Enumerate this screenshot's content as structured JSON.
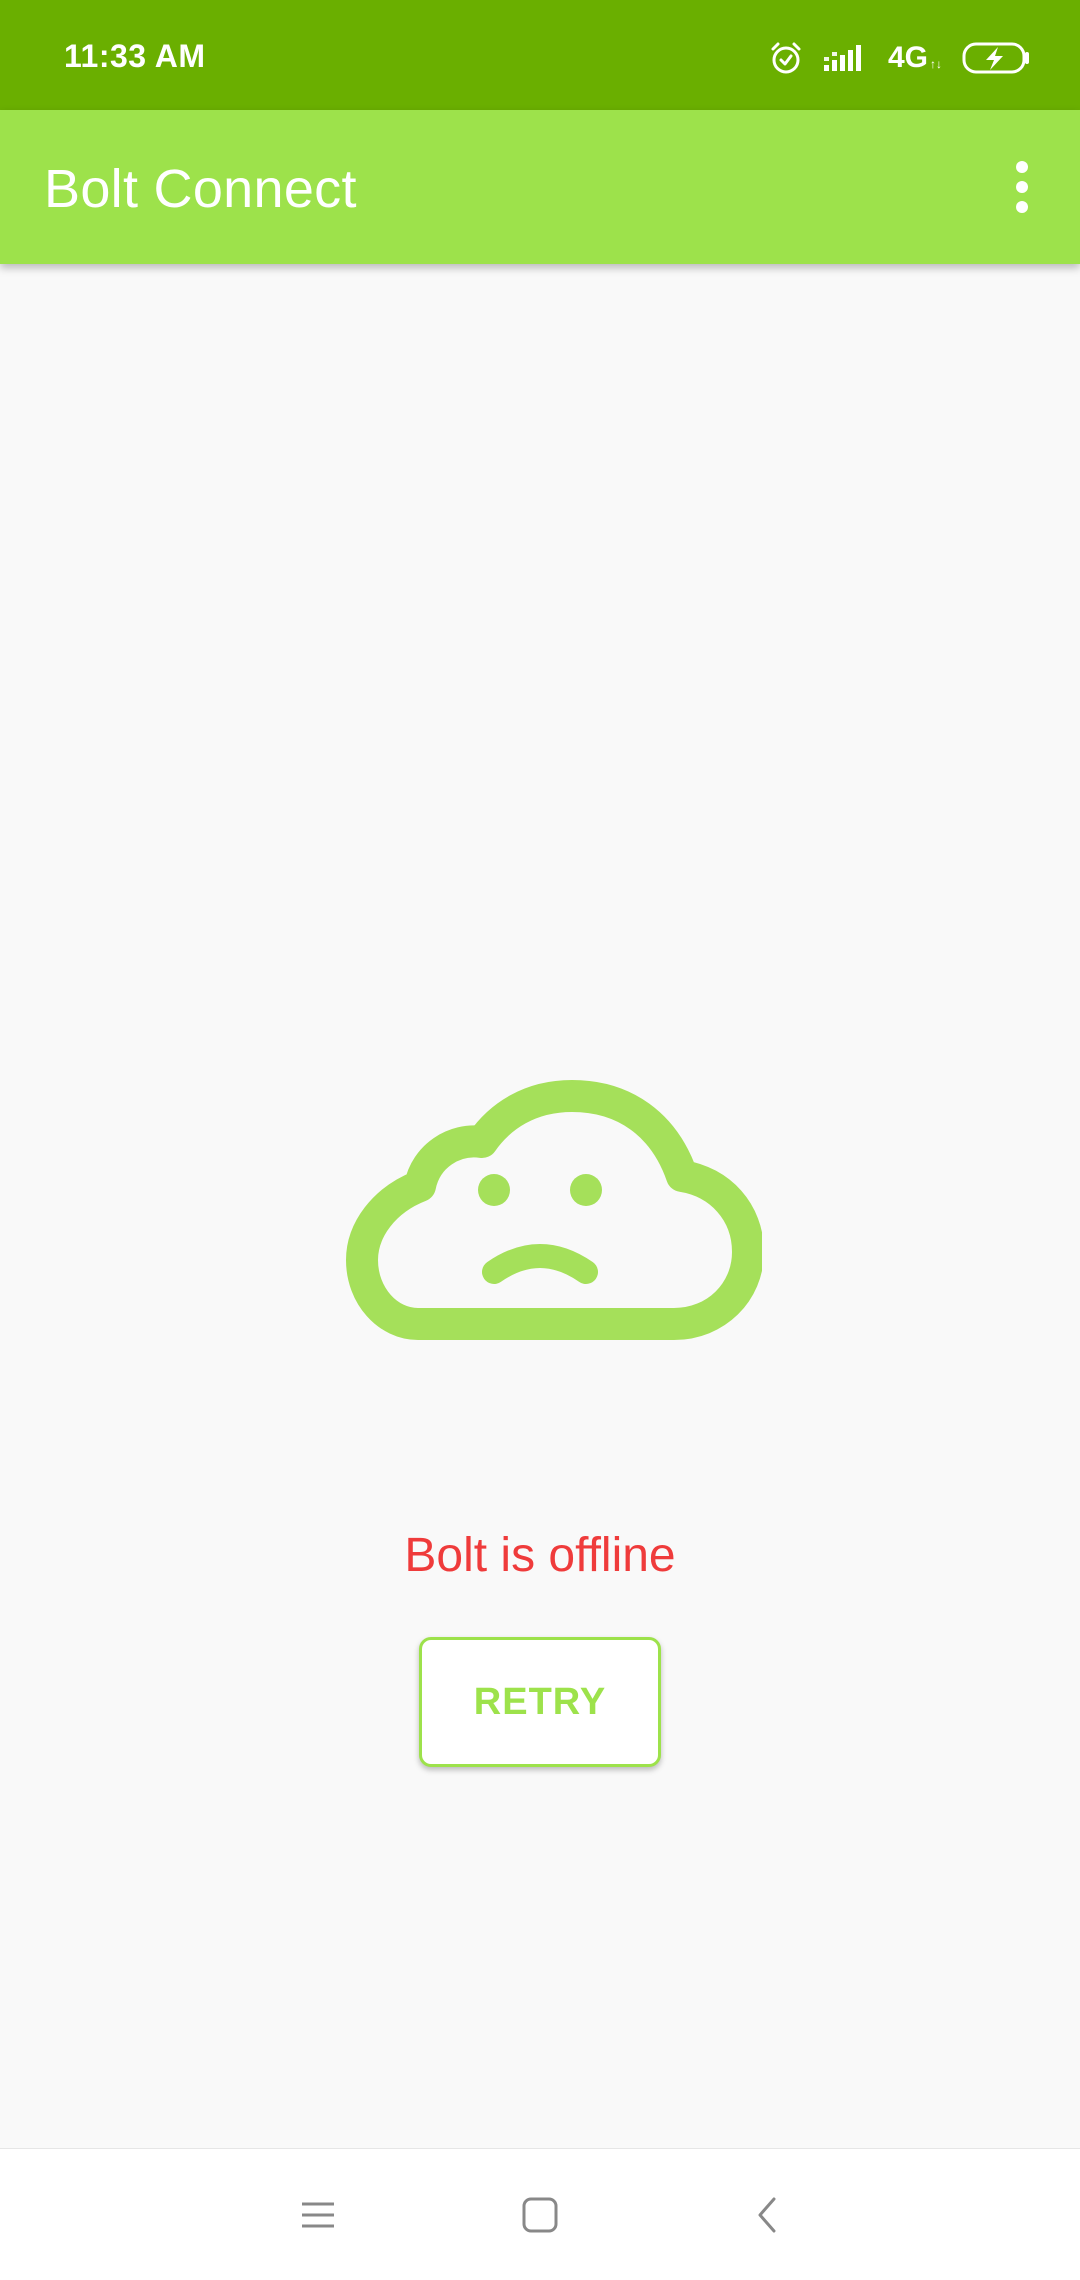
{
  "status_bar": {
    "time": "11:33 AM",
    "network_label": "4G",
    "network_sub": "↑↓",
    "icons": [
      "alarm-icon",
      "signal-icon",
      "battery-charging-icon"
    ]
  },
  "app_bar": {
    "title": "Bolt Connect",
    "menu_icon": "more-vert-icon"
  },
  "content": {
    "illustration_icon": "sad-cloud-icon",
    "status_message": "Bolt is offline",
    "retry_label": "RETRY"
  },
  "nav_bar": {
    "buttons": [
      "menu-icon",
      "home-icon",
      "back-icon"
    ]
  },
  "colors": {
    "status_bar_bg": "#6aaf00",
    "app_bar_bg": "#9de24b",
    "accent_green": "#9de24b",
    "cloud_green": "#a5e05a",
    "error_red": "#ef3b3b",
    "page_bg": "#f9f9f9"
  }
}
